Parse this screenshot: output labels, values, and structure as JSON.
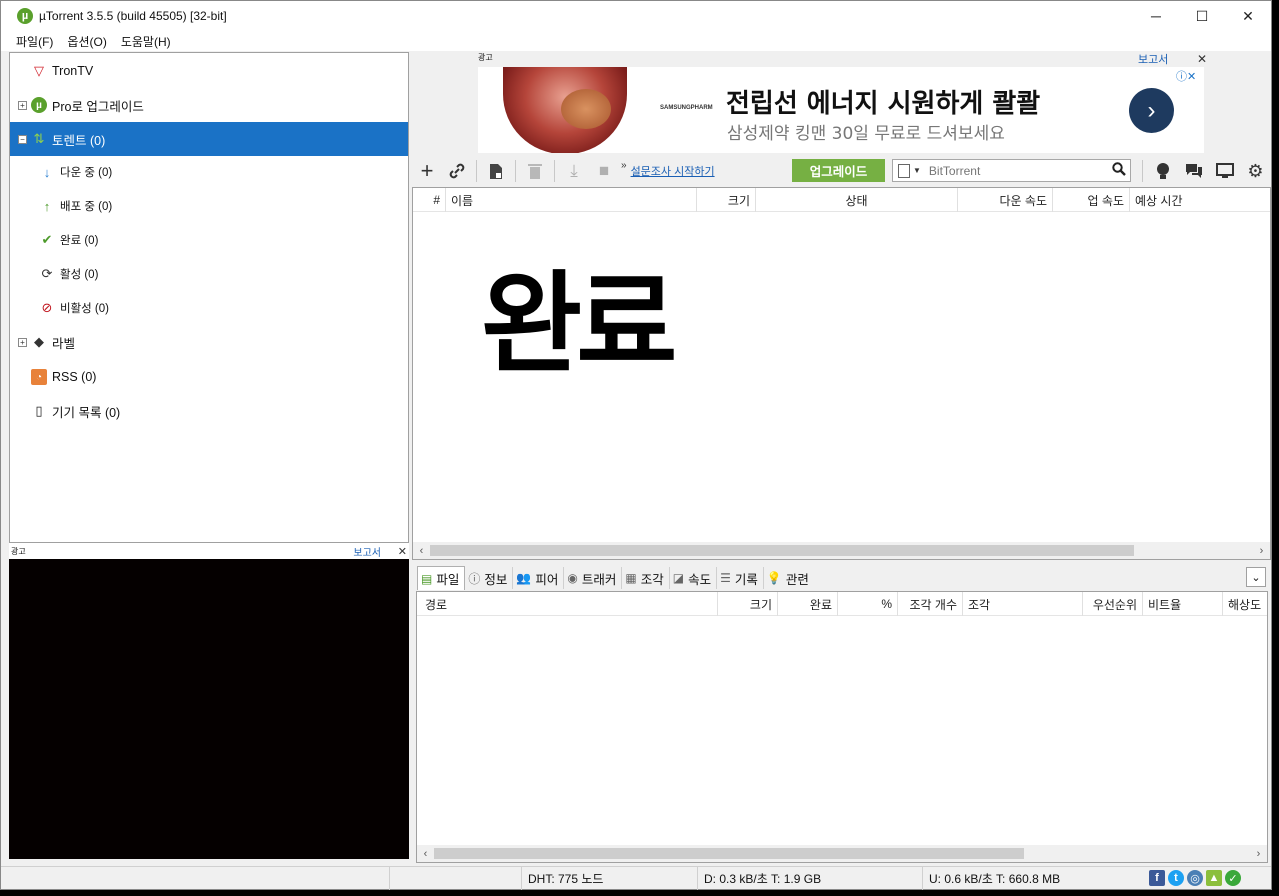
{
  "window": {
    "title": "µTorrent 3.5.5  (build 45505) [32-bit]",
    "app_icon": "utorrent-logo",
    "controls": {
      "minimize": "─",
      "maximize": "☐",
      "close": "✕"
    }
  },
  "menu": [
    "파일(F)",
    "옵션(O)",
    "도움말(H)"
  ],
  "sidebar": {
    "items": [
      {
        "label": "TronTV",
        "icon": "trontv-icon"
      },
      {
        "label": "Pro로 업그레이드",
        "icon": "utorrent-pro-icon",
        "expander": "+"
      },
      {
        "label": "토렌트 (0)",
        "icon": "torrents-icon",
        "expander": "−",
        "selected": true
      },
      {
        "label": "다운 중 (0)",
        "icon": "download-arrow-icon"
      },
      {
        "label": "배포 중 (0)",
        "icon": "upload-arrow-icon"
      },
      {
        "label": "완료 (0)",
        "icon": "checkmark-icon"
      },
      {
        "label": "활성 (0)",
        "icon": "refresh-icon"
      },
      {
        "label": "비활성 (0)",
        "icon": "inactive-icon"
      },
      {
        "label": "라벨",
        "icon": "tag-icon",
        "expander": "+"
      },
      {
        "label": "RSS (0)",
        "icon": "rss-icon"
      },
      {
        "label": "기기 목록 (0)",
        "icon": "device-icon"
      }
    ]
  },
  "left_ad": {
    "tag": "광고",
    "report": "보고서",
    "close": "✕"
  },
  "top_ad": {
    "tag": "광고",
    "report": "보고서",
    "close": "✕",
    "brand": "SAMSUNGPHARM",
    "headline": "전립선 에너지 시원하게 콸콸",
    "subline": "삼성제약 킹맨 30일 무료로 드셔보세요",
    "arrow": "›",
    "info": "ⓘ✕"
  },
  "toolbar": {
    "survey_link": "설문조사 시작하기",
    "more": "»",
    "upgrade_label": "업그레이드",
    "search_placeholder": "BitTorrent"
  },
  "main_list": {
    "columns": [
      "#",
      "이름",
      "크기",
      "상태",
      "다운 속도",
      "업 속도",
      "예상 시간"
    ],
    "overlay_text": "완료"
  },
  "detail_tabs": [
    {
      "label": "파일",
      "icon": "files-icon",
      "active": true
    },
    {
      "label": "정보",
      "icon": "info-icon"
    },
    {
      "label": "피어",
      "icon": "peers-icon"
    },
    {
      "label": "트래커",
      "icon": "trackers-icon"
    },
    {
      "label": "조각",
      "icon": "pieces-icon"
    },
    {
      "label": "속도",
      "icon": "speed-icon"
    },
    {
      "label": "기록",
      "icon": "log-icon"
    },
    {
      "label": "관련",
      "icon": "related-icon"
    }
  ],
  "detail_list": {
    "columns": [
      "경로",
      "크기",
      "완료",
      "%",
      "조각 개수",
      "조각",
      "우선순위",
      "비트율",
      "해상도"
    ]
  },
  "status": {
    "dht": "DHT: 775 노드",
    "download": "D: 0.3 kB/초 T: 1.9 GB",
    "upload": "U: 0.6 kB/초 T: 660.8 MB"
  },
  "colors": {
    "selected": "#1a72c6",
    "upgrade": "#76b043",
    "link": "#1a5fb4"
  }
}
